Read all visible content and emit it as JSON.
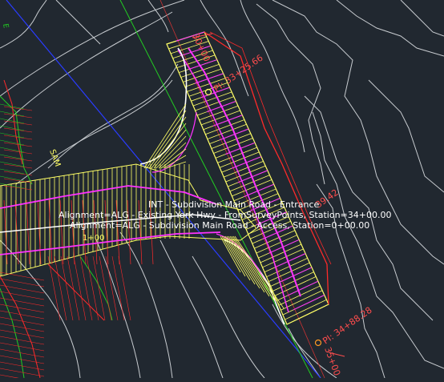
{
  "canvas": {
    "background": "#212830",
    "colors": {
      "contour": "#c8ccd0",
      "corridor": "#ffff66",
      "pavement": "#ff33ff",
      "edge_red": "#ff2a2a",
      "green": "#22cc22",
      "blue": "#2a3cff",
      "label_white": "#ffffff",
      "station_red": "#ff4d4d"
    }
  },
  "labels": {
    "int_label": "INT - Subdivision Main Road - Entrance",
    "alignment_1": "Alignment=ALG - Existing York Hwy - FromSurveyPoints, Station=34+00.00",
    "alignment_2": "Alignment=ALG - Subdivision Main Road - Access, Station=0+00.00"
  },
  "stations": {
    "top_station": "30+00",
    "pi_top": "PI: 33+25.66",
    "side_station": "39.42",
    "pi_bottom": "PI: 34+88.28",
    "bottom_station": "35+00",
    "left_station": "1+00",
    "left_vertical": "SAM"
  }
}
